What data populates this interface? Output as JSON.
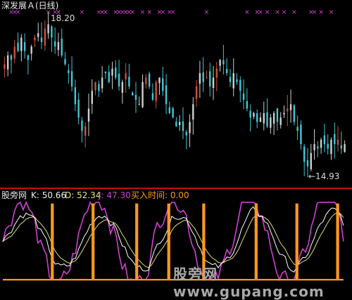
{
  "top_panel": {
    "title": "深发展Ａ(日线)",
    "high_marker": "18.20",
    "low_marker": "←14.93"
  },
  "bottom_panel": {
    "name": "股旁网",
    "k_text": "K: 50.66",
    "d_text": "D: 52.34",
    "j_text": "J: 47.30",
    "buy_text": "买入时间: 0.00"
  },
  "watermark": "股旁网 www.gupang.com",
  "colors": {
    "bg": "#000000",
    "up": "#d0d0d0",
    "down": "#3ec8d8",
    "red_candle": "#d0503a",
    "pink_marks": "#e040e0",
    "k_line": "#ffffff",
    "d_line": "#e0e070",
    "j_line": "#d040d0",
    "buy_line": "#ff9a1a",
    "separator": "#c01010"
  },
  "chart_data": [
    {
      "type": "candlestick",
      "title": "深发展Ａ(日线)",
      "ylim": [
        14.6,
        18.4
      ],
      "max_label": 18.2,
      "min_label": 14.93,
      "values": [
        17.3,
        17.5,
        17.4,
        17.7,
        17.6,
        17.9,
        17.6,
        17.4,
        17.7,
        17.9,
        18.0,
        17.8,
        18.1,
        18.2,
        17.9,
        17.7,
        17.8,
        17.5,
        17.3,
        17.1,
        16.8,
        16.4,
        16.1,
        15.8,
        15.9,
        16.3,
        16.7,
        16.9,
        16.7,
        17.0,
        17.1,
        16.9,
        17.2,
        17.0,
        16.8,
        16.9,
        17.1,
        16.8,
        16.6,
        16.5,
        16.4,
        16.9,
        17.0,
        16.8,
        16.5,
        16.9,
        17.0,
        16.7,
        16.4,
        16.2,
        16.1,
        15.9,
        16.0,
        15.8,
        15.7,
        16.0,
        16.4,
        16.8,
        17.1,
        16.9,
        17.0,
        16.8,
        17.0,
        17.2,
        17.4,
        17.3,
        17.1,
        16.9,
        17.1,
        16.9,
        16.7,
        16.5,
        16.3,
        16.1,
        16.2,
        16.0,
        16.1,
        16.2,
        15.9,
        16.1,
        16.2,
        16.0,
        16.1,
        16.2,
        16.3,
        16.4,
        16.0,
        15.8,
        15.5,
        15.1,
        15.0,
        15.3,
        15.5,
        15.4,
        15.6,
        15.5,
        15.4,
        15.6,
        15.5,
        15.6,
        15.4,
        15.5
      ]
    },
    {
      "type": "line",
      "title": "股旁网",
      "ylim": [
        -10,
        110
      ],
      "series": [
        {
          "name": "K",
          "values": [
            50.66,
            52.34,
            47.3
          ]
        },
        {
          "name": "D",
          "values": [
            52.34
          ]
        },
        {
          "name": "J",
          "values": [
            47.3
          ]
        },
        {
          "name": "买入时间",
          "values": [
            0.0
          ]
        }
      ],
      "buy_signal_positions": [
        17,
        31,
        46,
        57,
        69,
        87,
        101,
        115
      ]
    }
  ]
}
